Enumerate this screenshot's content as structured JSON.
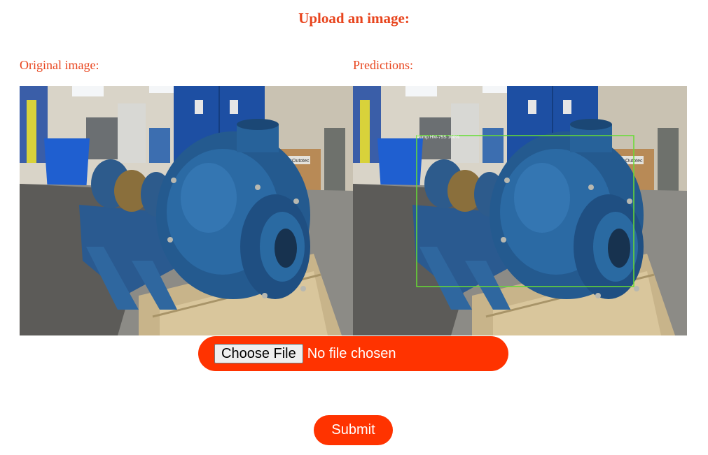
{
  "page": {
    "title": "Upload an image:"
  },
  "original": {
    "label": "Original image:",
    "image_subject": "blue centrifugal pump on a wooden pallet in a workshop",
    "sign_text": "Metso:Outotec"
  },
  "predictions": {
    "label": "Predictions:",
    "detection": {
      "label": "Pump HM-75S 100%",
      "box_color": "#66dd33"
    }
  },
  "upload": {
    "choose_label": "Choose File",
    "status": "No file chosen"
  },
  "submit": {
    "label": "Submit"
  },
  "colors": {
    "accent": "#ff3300",
    "heading": "#e8451e"
  }
}
